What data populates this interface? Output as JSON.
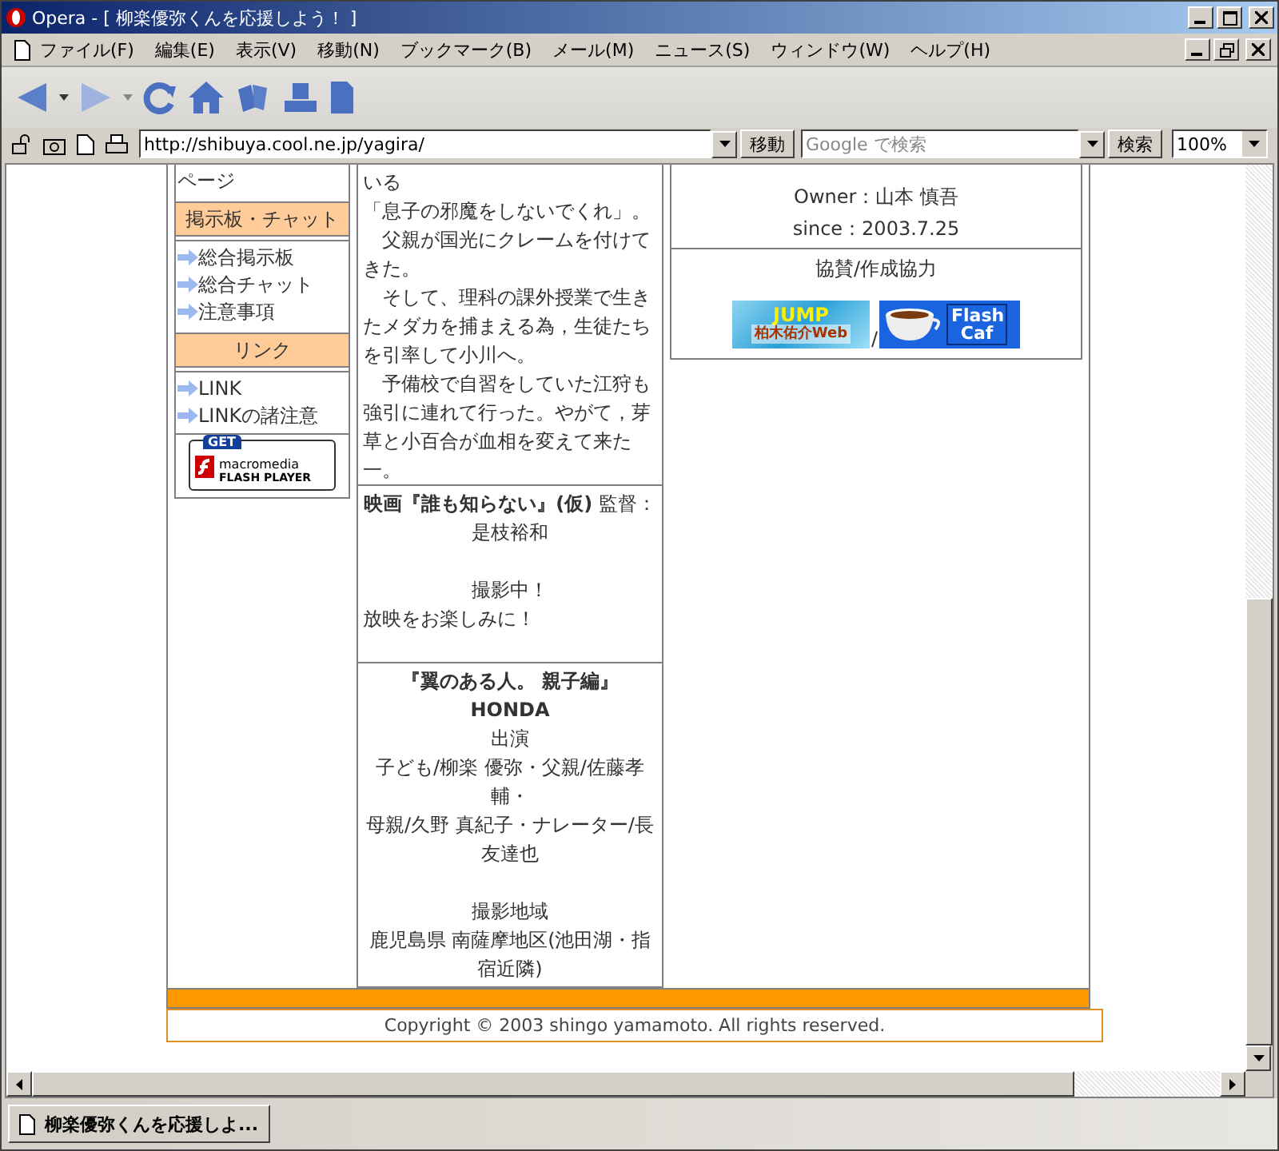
{
  "window": {
    "title": "Opera - [ 柳楽優弥くんを応援しよう！ ]"
  },
  "menu": [
    "ファイル(F)",
    "編集(E)",
    "表示(V)",
    "移動(N)",
    "ブックマーク(B)",
    "メール(M)",
    "ニュース(S)",
    "ウィンドウ(W)",
    "ヘルプ(H)"
  ],
  "address_bar": {
    "url": "http://shibuya.cool.ne.jp/yagira/",
    "go_button": "移動",
    "search_placeholder": "Google で検索",
    "search_button": "検索",
    "zoom": "100%"
  },
  "sidebar": [
    {
      "kind": "text",
      "text": "ページ"
    },
    {
      "kind": "header",
      "text": "掲示板・チャット"
    },
    {
      "kind": "links",
      "items": [
        "総合掲示板",
        "総合チャット",
        "注意事項"
      ]
    },
    {
      "kind": "header",
      "text": "リンク"
    },
    {
      "kind": "links",
      "items": [
        "LINK",
        "LINKの諸注意"
      ]
    },
    {
      "kind": "badge",
      "get": "GET",
      "brand": "macromedia",
      "product": "FLASH PLAYER"
    }
  ],
  "articles": [
    {
      "paragraphs": [
        {
          "text": "いる",
          "kind": "plain"
        },
        {
          "text": "「息子の邪魔をしないでくれ」。",
          "kind": "plain"
        },
        {
          "text": "　父親が国光にクレームを付けてきた。",
          "kind": "plain"
        },
        {
          "text": "　そして、理科の課外授業で生きたメダカを捕まえる為，生徒たちを引率して小川へ。",
          "kind": "plain"
        },
        {
          "text": "　予備校で自習をしていた江狩も強引に連れて行った。やがて，芽草と小百合が血相を変えて来た一。",
          "kind": "plain"
        }
      ]
    },
    {
      "paragraphs": [
        {
          "text": "**映画『誰も知らない』(仮)** 監督：是枝裕和",
          "kind": "centered"
        },
        {
          "text": "撮影中！",
          "kind": "spaced"
        },
        {
          "text": "放映をお楽しみに！",
          "kind": "plain"
        }
      ]
    },
    {
      "paragraphs": [
        {
          "text": "**『翼のある人。 親子編』HONDA**",
          "kind": "centered"
        },
        {
          "text": "出演",
          "kind": "centered"
        },
        {
          "text": "子ども/柳楽 優弥・父親/佐藤孝輔・",
          "kind": "centered"
        },
        {
          "text": "母親/久野 真紀子・ナレーター/長友達也",
          "kind": "centered"
        },
        {
          "text": "撮影地域",
          "kind": "spaced"
        },
        {
          "text": "鹿児島県 南薩摩地区(池田湖・指宿近隣)",
          "kind": "centered"
        }
      ]
    }
  ],
  "owner": {
    "owner": "Owner：山本 慎吾",
    "since": "since：2003.7.25"
  },
  "sponsors": {
    "heading": "協賛/作成協力",
    "banners": [
      {
        "kind": "jump",
        "title": "JUMP",
        "subtitle": "柏木佑介Web"
      },
      {
        "kind": "flash",
        "title": "Flash Caf"
      }
    ],
    "separator": "/"
  },
  "copyright": "Copyright © 2003 shingo yamamoto. All rights reserved.",
  "tab": {
    "title": "柳楽優弥くんを応援しよ..."
  }
}
